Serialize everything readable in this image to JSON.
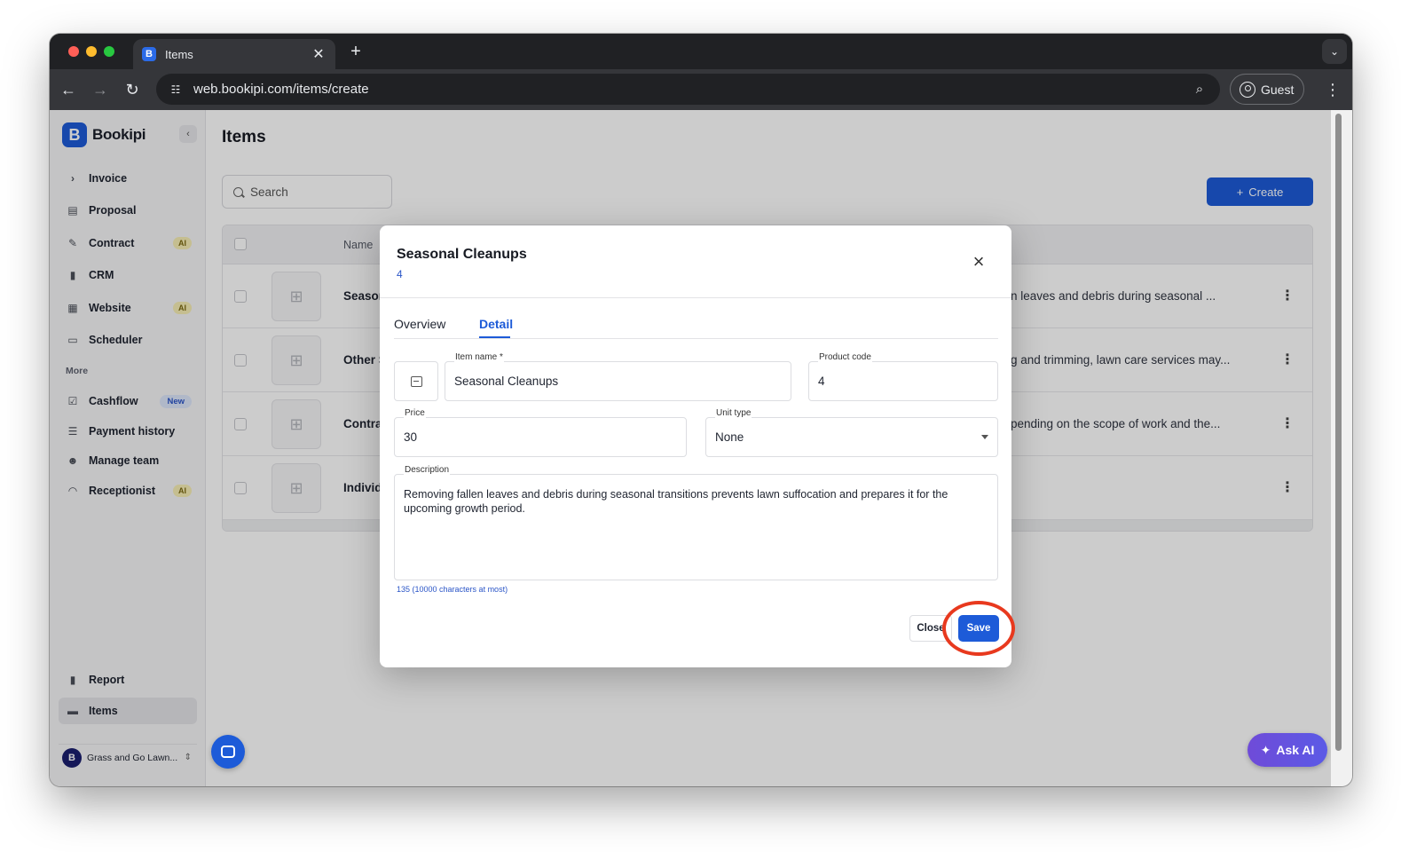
{
  "browser": {
    "tab_title": "Items",
    "tab_favicon": "bookipi-favicon",
    "url": "web.bookipi.com/items/create",
    "profile_label": "Guest"
  },
  "sidebar": {
    "brand": "Bookipi",
    "items": [
      {
        "label": "Invoice",
        "icon": "chevron-right-icon"
      },
      {
        "label": "Proposal",
        "icon": "proposal-icon"
      },
      {
        "label": "Contract",
        "icon": "contract-icon",
        "badge": "AI"
      },
      {
        "label": "CRM",
        "icon": "crm-icon"
      },
      {
        "label": "Website",
        "icon": "website-icon",
        "badge": "AI"
      },
      {
        "label": "Scheduler",
        "icon": "calendar-icon"
      }
    ],
    "more_label": "More",
    "more_items": [
      {
        "label": "Cashflow",
        "icon": "cashflow-icon",
        "badge": "New"
      },
      {
        "label": "Payment history",
        "icon": "payment-history-icon"
      },
      {
        "label": "Manage team",
        "icon": "team-icon"
      },
      {
        "label": "Receptionist",
        "icon": "headset-icon",
        "badge": "AI"
      }
    ],
    "bottom_items": [
      {
        "label": "Report",
        "icon": "report-icon"
      },
      {
        "label": "Items",
        "icon": "items-icon",
        "active": true
      }
    ],
    "org_name": "Grass and Go Lawn..."
  },
  "main": {
    "title": "Items",
    "search_placeholder": "Search",
    "create_label": "Create",
    "table": {
      "columns": [
        "Name"
      ],
      "rows": [
        {
          "name": "Seasor",
          "desc": "n leaves and debris during seasonal ..."
        },
        {
          "name": "Other S",
          "desc": "g and trimming, lawn care services may..."
        },
        {
          "name": "Contra",
          "desc": "pending on the scope of work and the..."
        },
        {
          "name": "Individ",
          "desc": ""
        }
      ]
    },
    "ask_ai_label": "Ask AI"
  },
  "modal": {
    "title": "Seasonal Cleanups",
    "subtitle": "4",
    "tabs": [
      "Overview",
      "Detail"
    ],
    "active_tab": "Detail",
    "fields": {
      "item_name": {
        "label": "Item name *",
        "value": "Seasonal Cleanups"
      },
      "product_code": {
        "label": "Product code",
        "value": "4"
      },
      "price": {
        "label": "Price",
        "value": "30"
      },
      "unit_type": {
        "label": "Unit type",
        "value": "None"
      },
      "description": {
        "label": "Description",
        "value": "Removing fallen leaves and debris during seasonal transitions prevents lawn suffocation and prepares it for the upcoming growth period."
      }
    },
    "char_count": "135 (10000 characters at most)",
    "close_label": "Close",
    "save_label": "Save"
  },
  "colors": {
    "primary": "#1d5bd8",
    "highlight": "#e8391e",
    "ai_badge": "#f7eeb4",
    "new_badge": "#dde7fb"
  }
}
